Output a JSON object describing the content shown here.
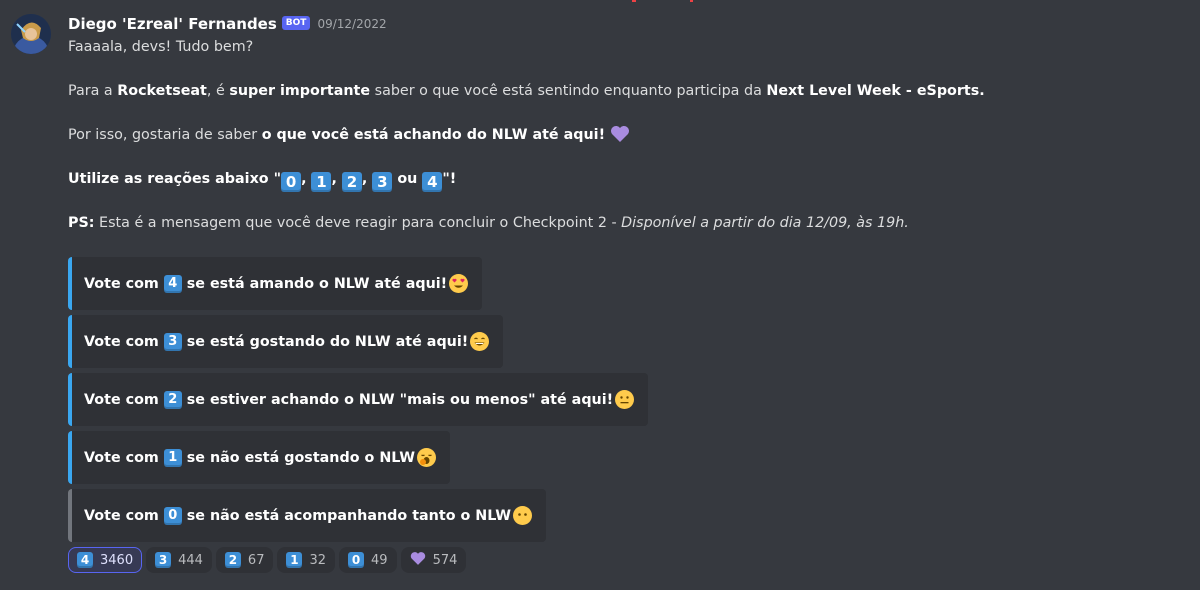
{
  "message": {
    "author": "Diego 'Ezreal' Fernandes",
    "badge": "BOT",
    "timestamp": "09/12/2022",
    "greeting": "Faaaala, devs! Tudo bem?",
    "p1": {
      "a": "Para a ",
      "b": "Rocketseat",
      "c": ", é ",
      "d": "super importante",
      "e": " saber o que você está sentindo enquanto participa da ",
      "f": "Next Level Week - eSports."
    },
    "p2": {
      "a": "Por isso, gostaria de saber ",
      "b": "o que você está achando do NLW até aqui!"
    },
    "p3": {
      "a": "Utilize as reações abaixo \"",
      "sep": ",",
      "or": "ou",
      "end": "\"!",
      "keys": [
        "0",
        "1",
        "2",
        "3",
        "4"
      ]
    },
    "ps": {
      "label": "PS:",
      "text": " Esta é a mensagem que você deve reagir para concluir o Checkpoint 2 - ",
      "italic": "Disponível a partir do dia 12/09, às 19h."
    }
  },
  "embeds": [
    {
      "prefix": "Vote com",
      "key": "4",
      "text": "se está amando o NLW até aqui!",
      "emoji": "heart-eyes-emoji",
      "color": "#3aa7f0"
    },
    {
      "prefix": "Vote com",
      "key": "3",
      "text": "se está gostando do NLW até aqui!",
      "emoji": "grinning-emoji",
      "color": "#3aa7f0"
    },
    {
      "prefix": "Vote com",
      "key": "2",
      "text": "se estiver achando o NLW \"mais ou menos\" até aqui!",
      "emoji": "neutral-face-emoji",
      "color": "#3aa7f0"
    },
    {
      "prefix": "Vote com",
      "key": "1",
      "text": "se não está gostando o NLW",
      "emoji": "yawning-face-emoji",
      "color": "#3aa7f0"
    },
    {
      "prefix": "Vote com",
      "key": "0",
      "text": "se não está acompanhando tanto o NLW",
      "emoji": "no-mouth-face-emoji",
      "color": "#72767d"
    }
  ],
  "reactions": [
    {
      "key": "4",
      "count": "3460",
      "active": true
    },
    {
      "key": "3",
      "count": "444"
    },
    {
      "key": "2",
      "count": "67"
    },
    {
      "key": "1",
      "count": "32"
    },
    {
      "key": "0",
      "count": "49"
    },
    {
      "key": "purple-heart-icon",
      "count": "574"
    }
  ],
  "colors": {
    "background": "#36393f",
    "embed_bg": "#2f3136",
    "keycap": "#3d8fd6",
    "bot_badge": "#5865f2",
    "purple_heart": "#a98ce0"
  }
}
